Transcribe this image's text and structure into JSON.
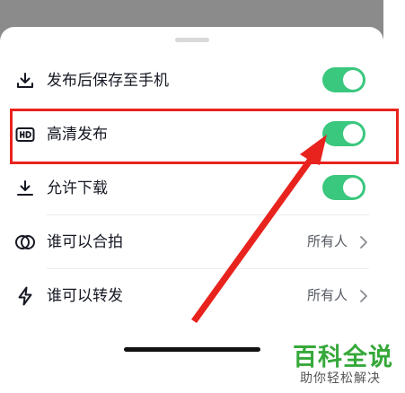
{
  "settings": {
    "items": [
      {
        "label": "发布后保存至手机",
        "icon": "download-icon",
        "toggle_on": true
      },
      {
        "label": "高清发布",
        "icon": "hd-icon",
        "toggle_on": true
      },
      {
        "label": "允许下载",
        "icon": "download-icon",
        "toggle_on": true
      },
      {
        "label": "谁可以合拍",
        "icon": "duet-icon",
        "value": "所有人"
      },
      {
        "label": "谁可以转发",
        "icon": "lightning-icon",
        "value": "所有人"
      }
    ]
  },
  "colors": {
    "toggle_on": "#3ac77e",
    "highlight": "#e8231e",
    "watermark_green": "#36a83a"
  },
  "watermark": {
    "title": "百科全说",
    "subtitle": "助你轻松解决"
  }
}
